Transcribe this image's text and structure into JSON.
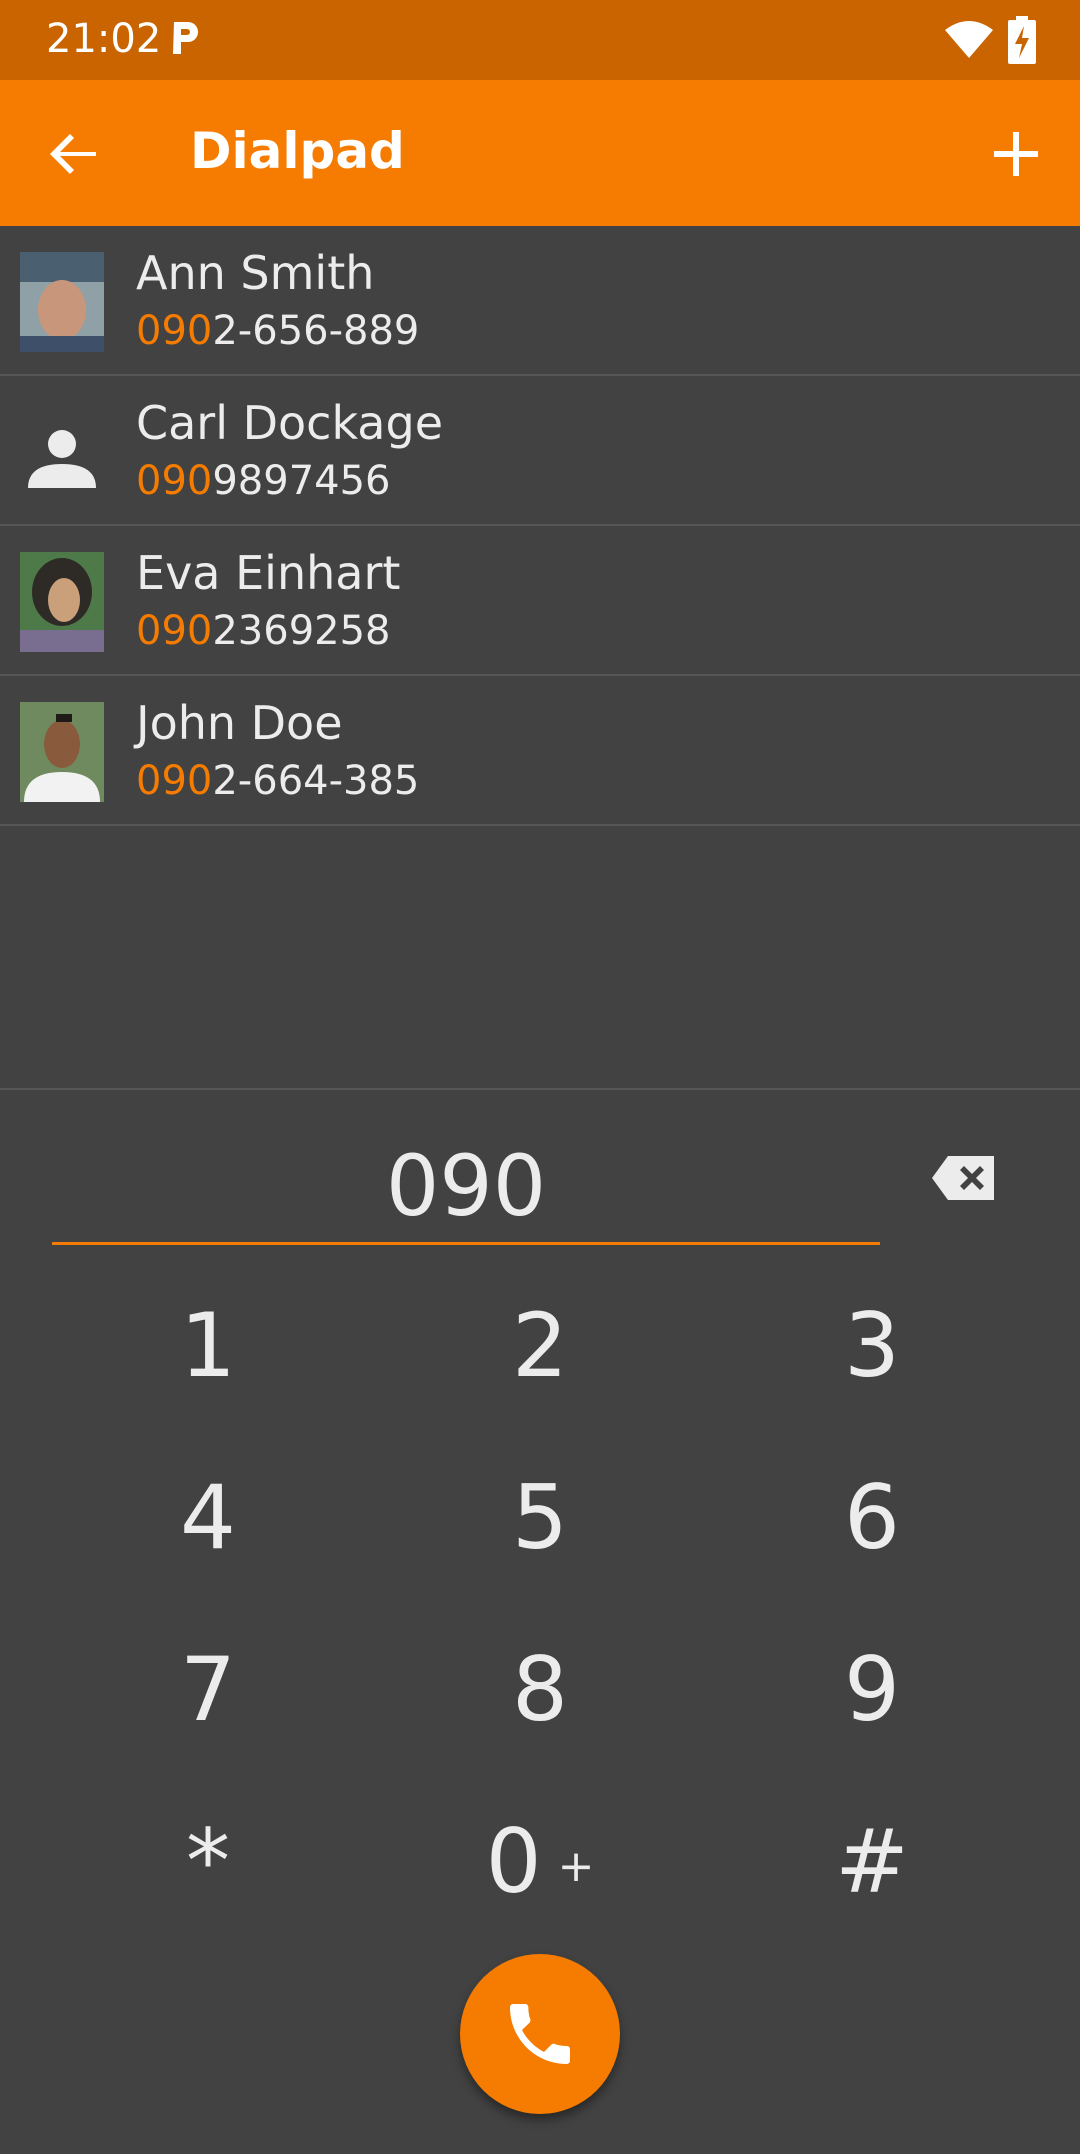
{
  "status_bar": {
    "time": "21:02"
  },
  "app_bar": {
    "title": "Dialpad"
  },
  "contacts": [
    {
      "name": "Ann Smith",
      "match": "090",
      "rest": "2-656-889",
      "avatar": "photo"
    },
    {
      "name": "Carl Dockage",
      "match": "090",
      "rest": "9897456",
      "avatar": "placeholder"
    },
    {
      "name": "Eva Einhart",
      "match": "090",
      "rest": "2369258",
      "avatar": "photo"
    },
    {
      "name": "John Doe",
      "match": "090",
      "rest": "2-664-385",
      "avatar": "photo"
    }
  ],
  "dialer": {
    "value": "090"
  },
  "keys": [
    "1",
    "2",
    "3",
    "4",
    "5",
    "6",
    "7",
    "8",
    "9",
    "*",
    "0",
    "#"
  ],
  "zero_sub": "+",
  "colors": {
    "accent": "#f57c00",
    "status_bar": "#c96400",
    "background": "#424242"
  },
  "icons": [
    "back-arrow-icon",
    "add-icon",
    "backspace-icon",
    "phone-icon",
    "person-icon",
    "wifi-icon",
    "battery-charging-icon"
  ]
}
